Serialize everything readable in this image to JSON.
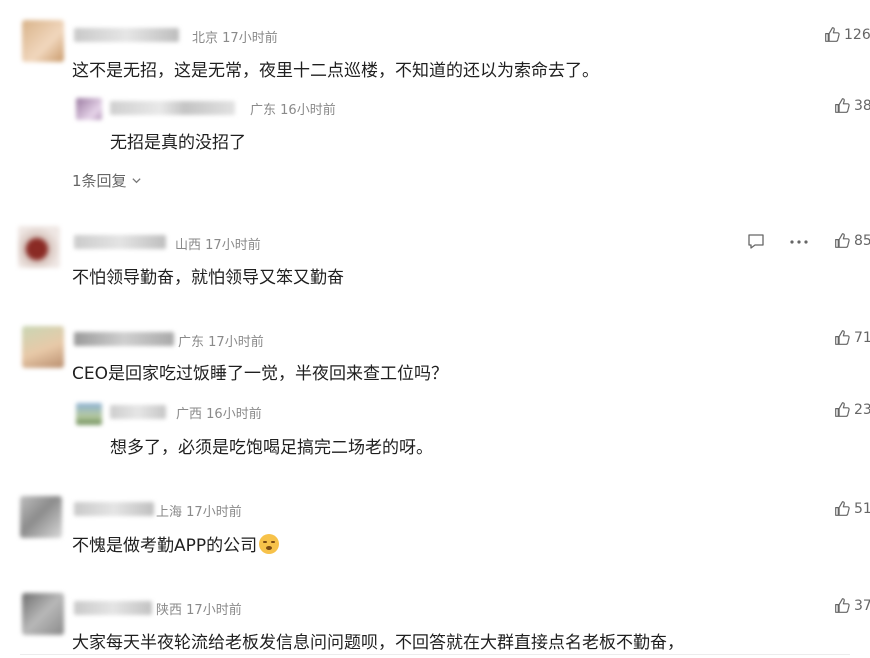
{
  "comments": [
    {
      "location": "北京",
      "time": "17小时前",
      "text": "这不是无招，这是无常，夜里十二点巡楼，不知道的还以为索命去了。",
      "likes": "126",
      "reply": {
        "location": "广东",
        "time": "16小时前",
        "text": "无招是真的没招了",
        "likes": "38"
      },
      "replies_label": "1条回复"
    },
    {
      "location": "山西",
      "time": "17小时前",
      "text": "不怕领导勤奋，就怕领导又笨又勤奋",
      "likes": "85"
    },
    {
      "location": "广东",
      "time": "17小时前",
      "text": "CEO是回家吃过饭睡了一觉，半夜回来查工位吗？",
      "likes": "71",
      "reply": {
        "location": "广西",
        "time": "16小时前",
        "text": "想多了，必须是吃饱喝足搞完二场老的呀。",
        "likes": "23"
      }
    },
    {
      "location": "上海",
      "time": "17小时前",
      "text": "不愧是做考勤APP的公司",
      "emoji": "relieved-face-emoji",
      "likes": "51"
    },
    {
      "location": "陕西",
      "time": "17小时前",
      "text": "大家每天半夜轮流给老板发信息问问题呗，不回答就在大群直接点名老板不勤奋，",
      "likes": "37"
    }
  ],
  "colors": {
    "meta": "#8a8a8a",
    "text": "#1f1f1f",
    "icon": "#666666"
  }
}
